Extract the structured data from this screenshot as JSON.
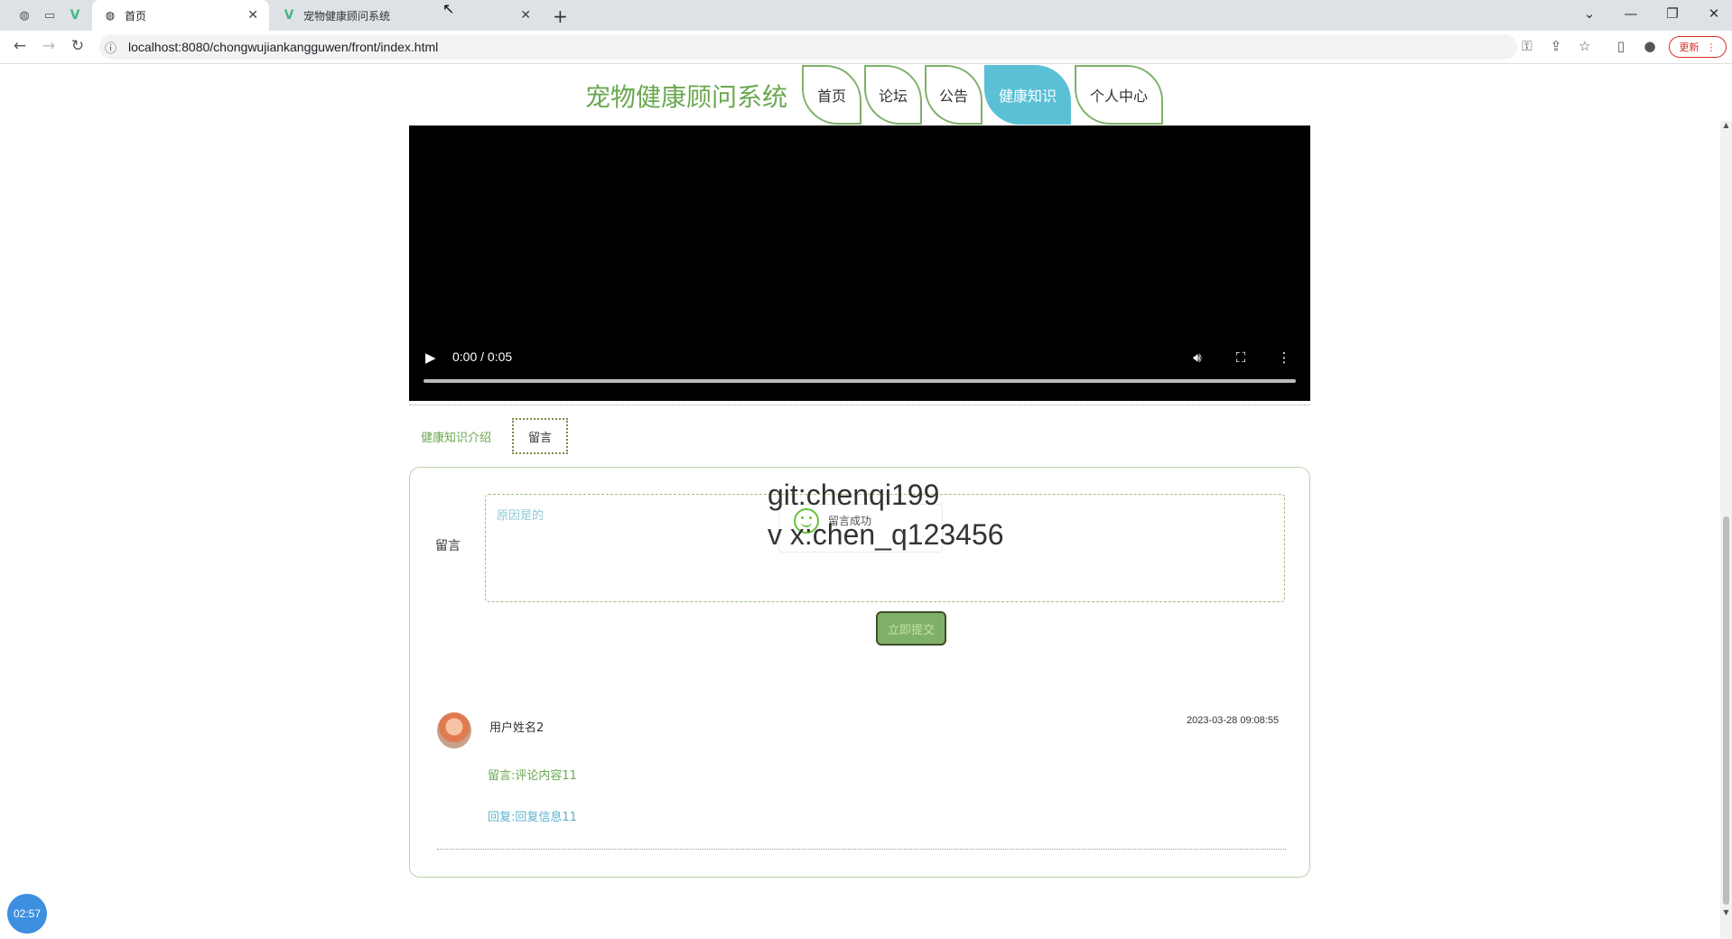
{
  "browser": {
    "tabs": [
      {
        "title": "首页",
        "active": true
      },
      {
        "title": "宠物健康顾问系统",
        "active": false
      }
    ],
    "url": "localhost:8080/chongwujiankangguwen/front/index.html",
    "update_label": "更新"
  },
  "site": {
    "title": "宠物健康顾问系统",
    "nav": [
      {
        "label": "首页",
        "active": false
      },
      {
        "label": "论坛",
        "active": false
      },
      {
        "label": "公告",
        "active": false
      },
      {
        "label": "健康知识",
        "active": true
      },
      {
        "label": "个人中心",
        "active": false
      }
    ]
  },
  "video": {
    "time": "0:00 / 0:05",
    "progress": 0
  },
  "tabs": {
    "intro": "健康知识介绍",
    "comment": "留言"
  },
  "form": {
    "label": "留言",
    "value": "原因是的",
    "submit": "立即提交"
  },
  "toast": {
    "message": "留言成功"
  },
  "watermark": {
    "line1": "git:chenqi199",
    "line2": "v x:chen_q123456"
  },
  "comment": {
    "username": "用户姓名2",
    "time": "2023-03-28 09:08:55",
    "content": "留言:评论内容11",
    "reply": "回复:回复信息11"
  },
  "timer": "02:57",
  "colors": {
    "accent_green": "#6aa84f",
    "active_nav": "#5bc0d6",
    "button": "#7fb069"
  }
}
